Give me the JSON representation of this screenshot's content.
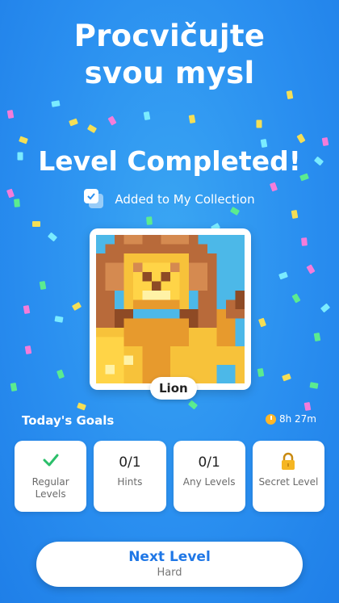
{
  "headline": {
    "line1": "Procvičujte",
    "line2": "svou mysl"
  },
  "completion": {
    "title": "Level Completed!",
    "collection_text": "Added to My Collection"
  },
  "artwork": {
    "name": "Lion"
  },
  "goals": {
    "title": "Today's Goals",
    "timer": "8h 27m",
    "items": [
      {
        "value": "",
        "label": "Regular Levels",
        "status": "completed"
      },
      {
        "value": "0/1",
        "label": "Hints"
      },
      {
        "value": "0/1",
        "label": "Any Levels"
      },
      {
        "value": "",
        "label": "Secret Level",
        "status": "locked"
      }
    ]
  },
  "next_button": {
    "label": "Next Level",
    "sublabel": "Hard"
  },
  "colors": {
    "background": "#2a8ff0",
    "accent": "#1f77e6",
    "check": "#2bbf6a",
    "lock": "#f5b622"
  }
}
